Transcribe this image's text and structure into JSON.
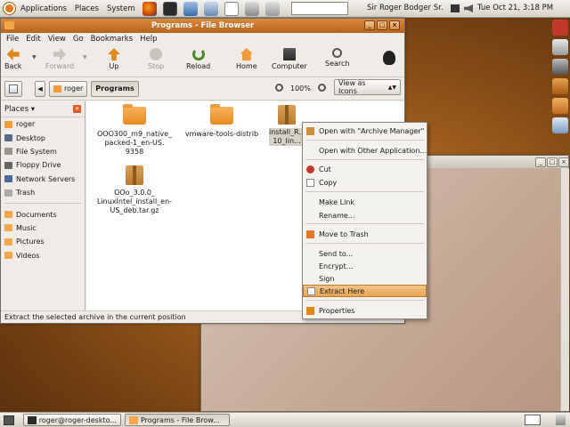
{
  "panel": {
    "applications": "Applications",
    "places": "Places",
    "system": "System",
    "user": "Sir Roger Bodger Sr.",
    "clock": "Tue Oct 21,  3:18 PM"
  },
  "colors": {
    "accent": "#d88a3e",
    "highlight": "#e7a454",
    "desktop": "#9a5a1c"
  },
  "filebrowser": {
    "title": "Programs - File Browser",
    "menus": [
      "File",
      "Edit",
      "View",
      "Go",
      "Bookmarks",
      "Help"
    ],
    "toolbar": {
      "back": "Back",
      "forward": "Forward",
      "up": "Up",
      "stop": "Stop",
      "reload": "Reload",
      "home": "Home",
      "computer": "Computer",
      "search": "Search"
    },
    "path": [
      "roger",
      "Programs"
    ],
    "zoom": "100%",
    "view_mode": "View as Icons",
    "places_label": "Places",
    "places": [
      "roger",
      "Desktop",
      "File System",
      "Floppy Drive",
      "Network Servers",
      "Trash",
      "Documents",
      "Music",
      "Pictures",
      "Videos"
    ],
    "files": [
      {
        "name": "OOO300_m9_native_ packed-1_en-US. 9358"
      },
      {
        "name": "vmware-tools-distrib"
      },
      {
        "name": "install_R... 10_lin..."
      },
      {
        "name": "OOo_3.0.0_ LinuxIntel_install_en- US_deb.tar.gz"
      }
    ],
    "status": "Extract the selected archive in the current position"
  },
  "context_menu": [
    {
      "label": "Open with \"Archive Manager\"",
      "icon": "archive-icon"
    },
    {
      "label": "Open with Other Application..."
    },
    {
      "label": "Cut",
      "icon": "scissors-icon"
    },
    {
      "label": "Copy",
      "icon": "copy-icon"
    },
    {
      "label": "Make Link"
    },
    {
      "label": "Rename..."
    },
    {
      "label": "Move to Trash",
      "icon": "trash-icon"
    },
    {
      "label": "Send to..."
    },
    {
      "label": "Encrypt..."
    },
    {
      "label": "Sign"
    },
    {
      "label": "Extract Here",
      "highlighted": true,
      "icon": "extract-icon"
    },
    {
      "label": "Properties",
      "icon": "properties-icon"
    }
  ],
  "taskbar": [
    "roger@roger-deskto...",
    "Programs - File Brow..."
  ]
}
